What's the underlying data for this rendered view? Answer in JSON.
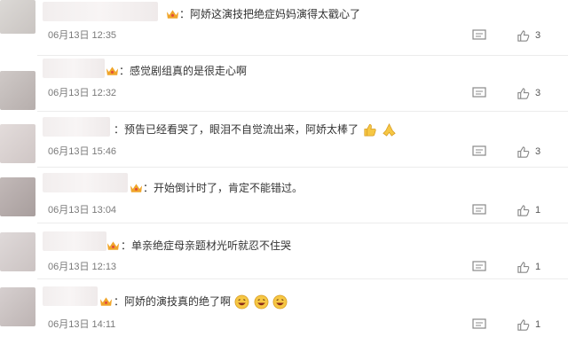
{
  "comments": [
    {
      "text": "：阿娇这演技把绝症妈妈演得太戳心了",
      "date": "06月13日 12:35",
      "likes": "3"
    },
    {
      "text": "：感觉剧组真的是很走心啊",
      "date": "06月13日 12:32",
      "likes": "3"
    },
    {
      "text": "：预告已经看哭了，眼泪不自觉流出来，阿娇太棒了",
      "date": "06月13日 15:46",
      "likes": "3"
    },
    {
      "text": "：开始倒计时了，肯定不能错过。",
      "date": "06月13日 13:04",
      "likes": "1"
    },
    {
      "text": "：单亲绝症母亲题材光听就忍不住哭",
      "date": "06月13日 12:13",
      "likes": "1"
    },
    {
      "text": "：阿娇的演技真的绝了啊",
      "date": "06月13日 14:11",
      "likes": "1"
    }
  ],
  "icons": {
    "badge": "crown-badge-icon",
    "reply": "comment-icon",
    "like": "thumbs-up-icon",
    "emoji_like": "thumbs-up-emoji-icon",
    "emoji_pray": "praying-hands-emoji-icon",
    "emoji_laugh": "laughing-face-emoji-icon"
  },
  "colors": {
    "text": "#333333",
    "meta": "#7a7a7a",
    "crown": "#f0a52a"
  }
}
